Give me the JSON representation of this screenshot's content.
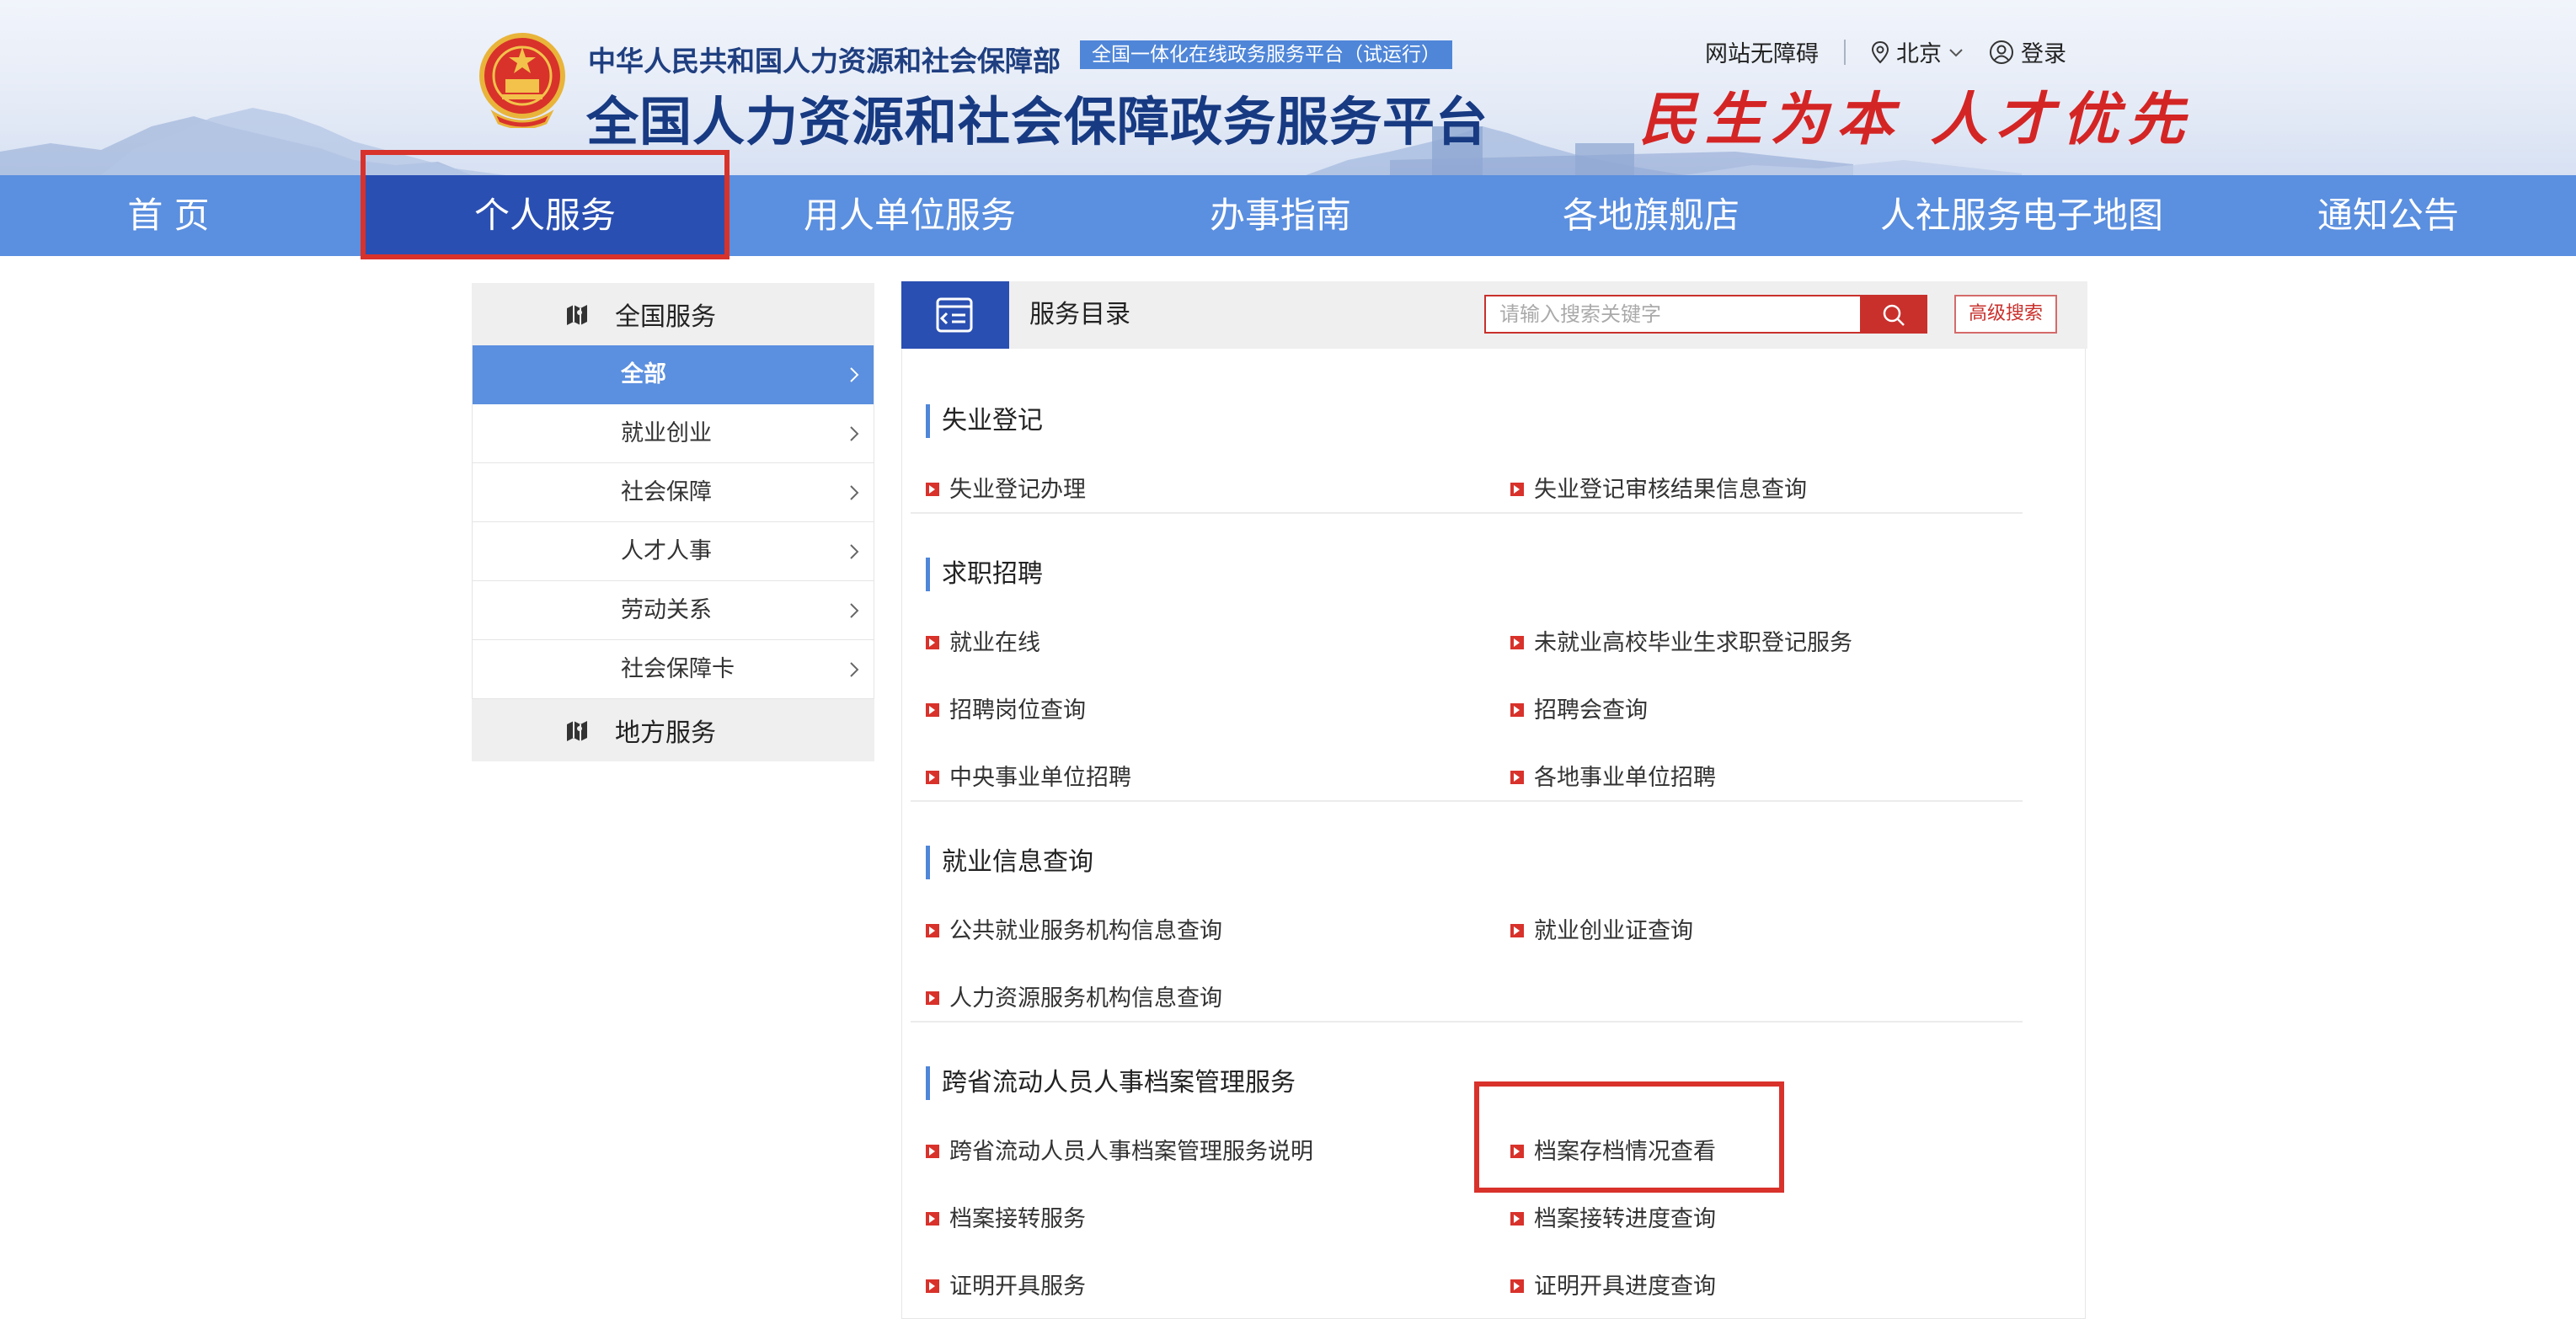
{
  "header": {
    "ministry": "中华人民共和国人力资源和社会保障部",
    "badge": "全国一体化在线政务服务平台（试运行）",
    "title": "全国人力资源和社会保障政务服务平台",
    "slogan": "民生为本  人才优先",
    "accessibility_label": "网站无障碍",
    "location_label": "北京",
    "login_label": "登录"
  },
  "nav": {
    "items": [
      "首 页",
      "个人服务",
      "用人单位服务",
      "办事指南",
      "各地旗舰店",
      "人社服务电子地图",
      "通知公告"
    ],
    "active_index": 1
  },
  "sidebar": {
    "national_label": "全国服务",
    "items": [
      "全部",
      "就业创业",
      "社会保障",
      "人才人事",
      "劳动关系",
      "社会保障卡"
    ],
    "active_index": 0,
    "local_label": "地方服务"
  },
  "main": {
    "title": "服务目录",
    "search_placeholder": "请输入搜索关键字",
    "advanced_search_label": "高级搜索",
    "sections": [
      {
        "title": "失业登记",
        "links": [
          "失业登记办理",
          "失业登记审核结果信息查询"
        ]
      },
      {
        "title": "求职招聘",
        "links": [
          "就业在线",
          "未就业高校毕业生求职登记服务",
          "招聘岗位查询",
          "招聘会查询",
          "中央事业单位招聘",
          "各地事业单位招聘"
        ]
      },
      {
        "title": "就业信息查询",
        "links": [
          "公共就业服务机构信息查询",
          "就业创业证查询",
          "人力资源服务机构信息查询"
        ]
      },
      {
        "title": "跨省流动人员人事档案管理服务",
        "links": [
          "跨省流动人员人事档案管理服务说明",
          "档案存档情况查看",
          "档案接转服务",
          "档案接转进度查询",
          "证明开具服务",
          "证明开具进度查询"
        ]
      }
    ]
  },
  "colors": {
    "nav_bg": "#5b8fdf",
    "nav_active": "#2a4fb2",
    "accent_red": "#d8322b",
    "highlight_box": "#d8322b"
  }
}
